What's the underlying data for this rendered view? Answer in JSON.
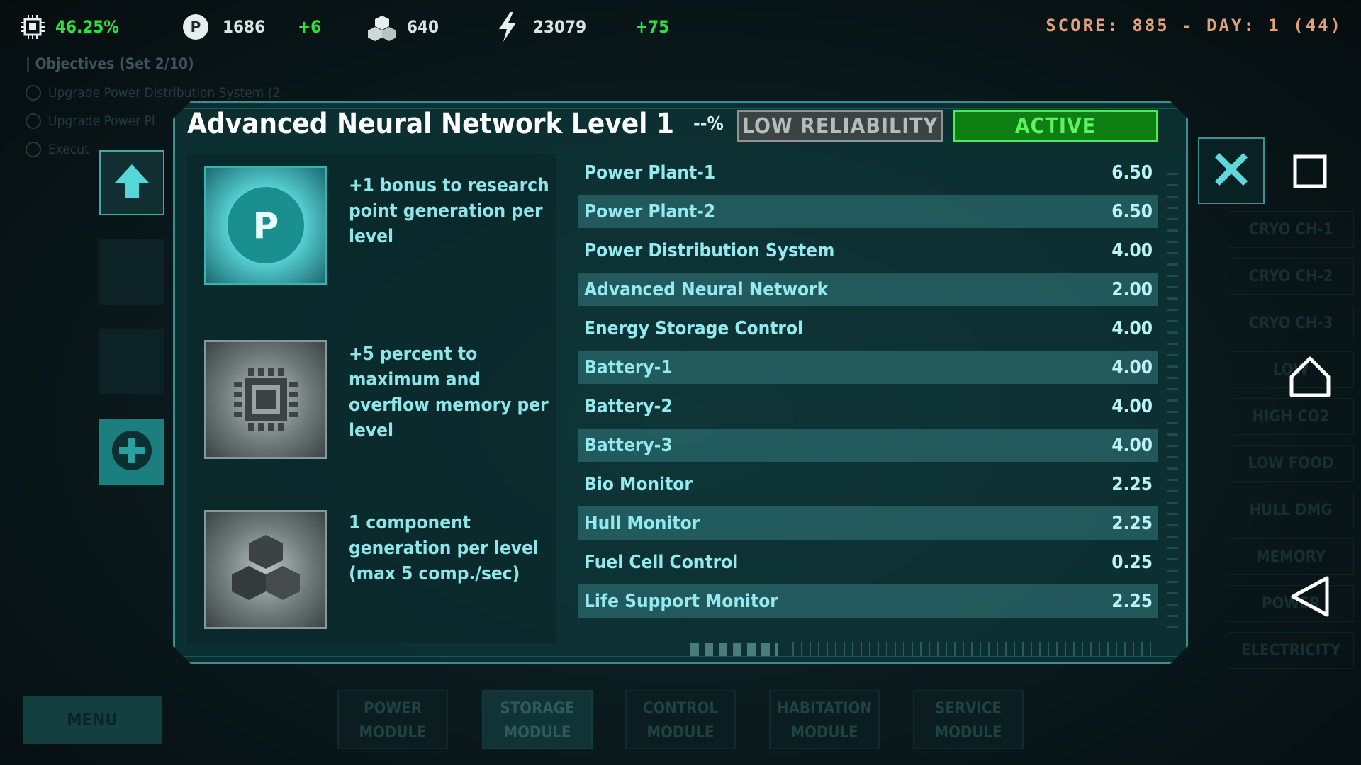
{
  "hud": {
    "cpu_percent": "46.25%",
    "research_points": "1686",
    "research_delta": "+6",
    "components": "640",
    "energy": "23079",
    "energy_delta": "+75",
    "score_text": "SCORE: 885 - DAY: 1 (44)"
  },
  "objectives": {
    "title": "| Objectives (Set 2/10)",
    "items": [
      "Upgrade Power Distribution System (2",
      "Upgrade Power Pl",
      "Execut"
    ]
  },
  "right_labels": [
    "CRYO CH-1",
    "CRYO CH-2",
    "CRYO CH-3",
    "LOW",
    "HIGH CO2",
    "LOW FOOD",
    "HULL DMG",
    "MEMORY",
    "POWER",
    "ELECTRICITY"
  ],
  "dialog": {
    "title": "Advanced Neural Network Level 1",
    "percent": "--%",
    "reliability_badge": "LOW RELIABILITY",
    "status_badge": "ACTIVE",
    "perks": [
      {
        "icon": "research-point-icon",
        "text": "+1 bonus to research point generation per level"
      },
      {
        "icon": "chip-icon",
        "text": "+5 percent to maximum and overflow memory per level"
      },
      {
        "icon": "component-icon",
        "text": "1 component generation per level (max 5 comp./sec)"
      }
    ],
    "rows": [
      {
        "name": "Power Plant-1",
        "value": "6.50"
      },
      {
        "name": "Power Plant-2",
        "value": "6.50"
      },
      {
        "name": "Power Distribution System",
        "value": "4.00"
      },
      {
        "name": "Advanced Neural Network",
        "value": "2.00"
      },
      {
        "name": "Energy Storage Control",
        "value": "4.00"
      },
      {
        "name": "Battery-1",
        "value": "4.00"
      },
      {
        "name": "Battery-2",
        "value": "4.00"
      },
      {
        "name": "Battery-3",
        "value": "4.00"
      },
      {
        "name": "Bio Monitor",
        "value": "2.25"
      },
      {
        "name": "Hull Monitor",
        "value": "2.25"
      },
      {
        "name": "Fuel Cell Control",
        "value": "0.25"
      },
      {
        "name": "Life Support Monitor",
        "value": "2.25"
      }
    ]
  },
  "bottom": {
    "menu_label": "MENU",
    "modules": [
      {
        "line1": "POWER",
        "line2": "MODULE"
      },
      {
        "line1": "STORAGE",
        "line2": "MODULE"
      },
      {
        "line1": "CONTROL",
        "line2": "MODULE"
      },
      {
        "line1": "HABITATION",
        "line2": "MODULE"
      },
      {
        "line1": "SERVICE",
        "line2": "MODULE"
      }
    ]
  },
  "colors": {
    "accent_green": "#2fe13f",
    "score_orange": "#e2a078",
    "panel_teal": "#3c8d90",
    "active_green": "#0f7f14"
  }
}
